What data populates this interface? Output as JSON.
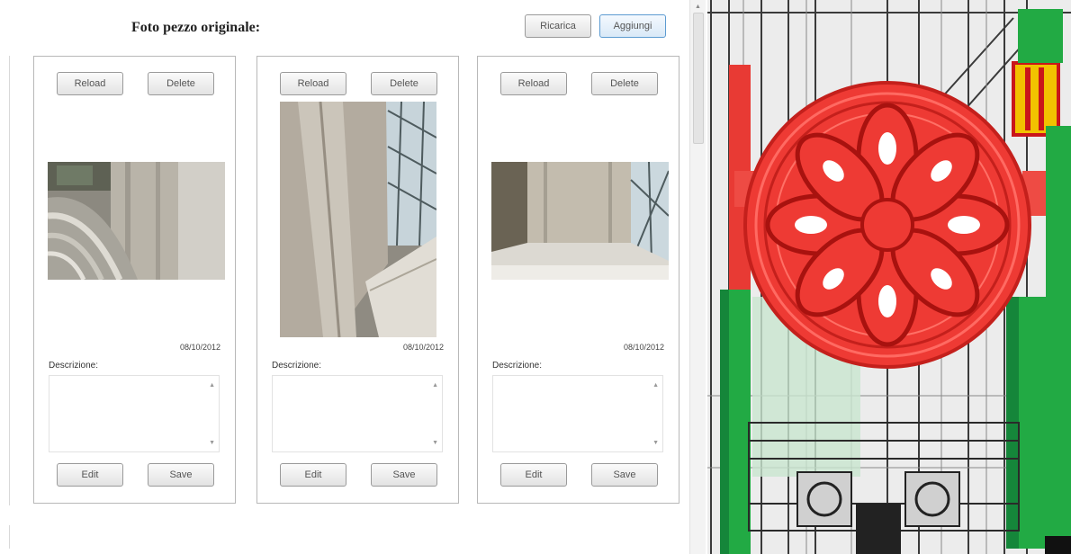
{
  "panel": {
    "title": "Foto pezzo originale:",
    "refresh_label": "Ricarica",
    "add_label": "Aggiungi"
  },
  "photos": [
    {
      "reload_label": "Reload",
      "delete_label": "Delete",
      "date": "08/10/2012",
      "description_label": "Descrizione:",
      "description_value": "",
      "edit_label": "Edit",
      "save_label": "Save"
    },
    {
      "reload_label": "Reload",
      "delete_label": "Delete",
      "date": "08/10/2012",
      "description_label": "Descrizione:",
      "description_value": "",
      "edit_label": "Edit",
      "save_label": "Save"
    },
    {
      "reload_label": "Reload",
      "delete_label": "Delete",
      "date": "08/10/2012",
      "description_label": "Descrizione:",
      "description_value": "",
      "edit_label": "Edit",
      "save_label": "Save"
    }
  ],
  "colors": {
    "selected_element": "#ee3333",
    "other_elements": "#22aa44",
    "highlight": "#f2c200",
    "accent_button": "#5c9bd1"
  }
}
